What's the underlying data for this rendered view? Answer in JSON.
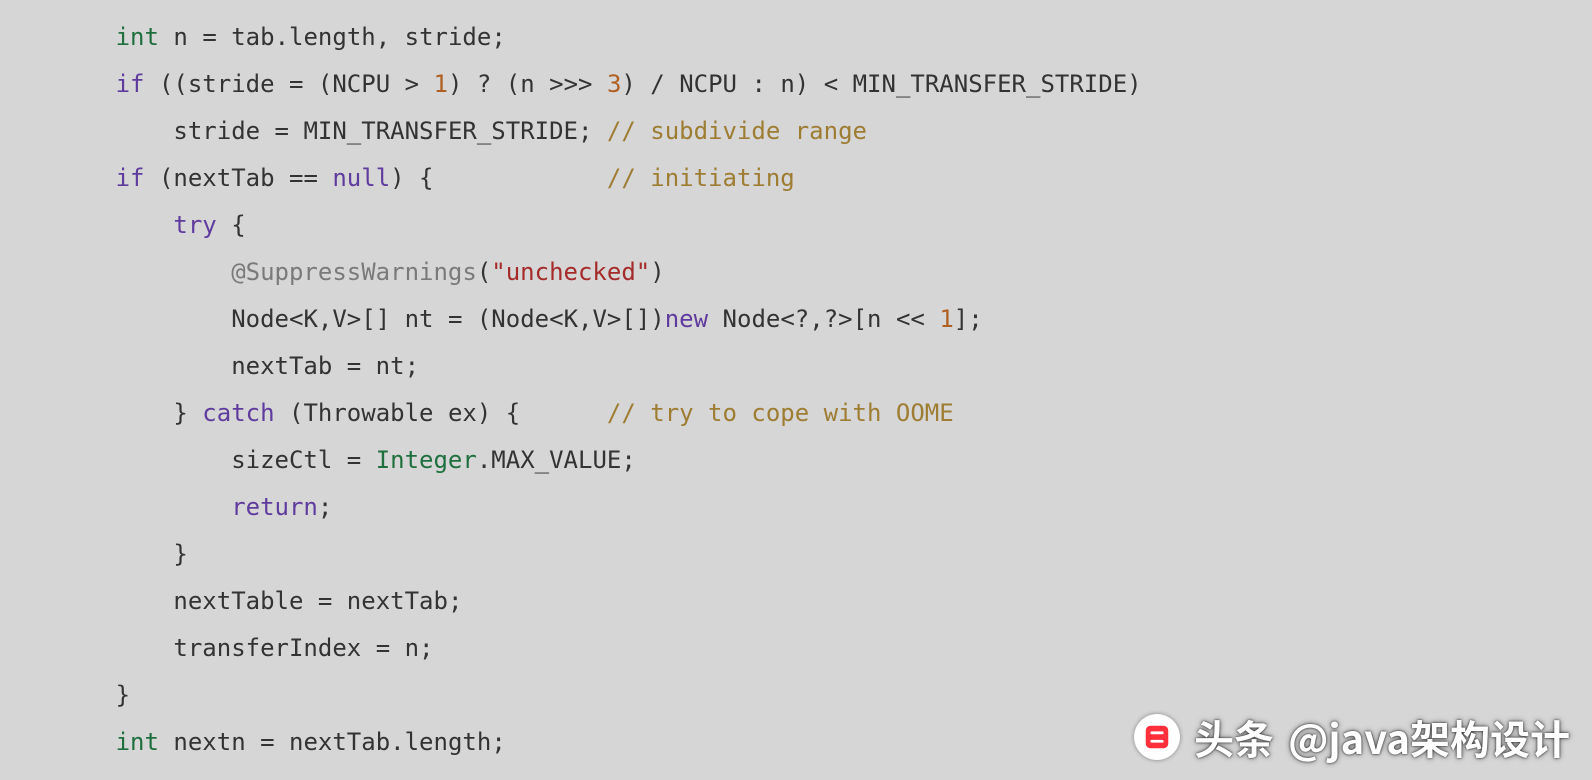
{
  "code": {
    "indent": "        ",
    "lines": [
      [
        {
          "cls": "type",
          "t": "int"
        },
        {
          "cls": "op",
          "t": " n "
        },
        {
          "cls": "op",
          "t": "="
        },
        {
          "cls": "op",
          "t": " tab"
        },
        {
          "cls": "op",
          "t": "."
        },
        {
          "cls": "id",
          "t": "length"
        },
        {
          "cls": "op",
          "t": ", stride;"
        }
      ],
      [
        {
          "cls": "kw",
          "t": "if"
        },
        {
          "cls": "op",
          "t": " ((stride "
        },
        {
          "cls": "op",
          "t": "="
        },
        {
          "cls": "op",
          "t": " (NCPU "
        },
        {
          "cls": "op",
          "t": ">"
        },
        {
          "cls": "op",
          "t": " "
        },
        {
          "cls": "num",
          "t": "1"
        },
        {
          "cls": "op",
          "t": ") "
        },
        {
          "cls": "op",
          "t": "?"
        },
        {
          "cls": "op",
          "t": " (n "
        },
        {
          "cls": "op",
          "t": ">>>"
        },
        {
          "cls": "op",
          "t": " "
        },
        {
          "cls": "num",
          "t": "3"
        },
        {
          "cls": "op",
          "t": ") "
        },
        {
          "cls": "op",
          "t": "/"
        },
        {
          "cls": "op",
          "t": " NCPU "
        },
        {
          "cls": "op",
          "t": ":"
        },
        {
          "cls": "op",
          "t": " n) "
        },
        {
          "cls": "op",
          "t": "<"
        },
        {
          "cls": "op",
          "t": " MIN_TRANSFER_STRIDE)"
        }
      ],
      [
        {
          "cls": "op",
          "t": "    stride "
        },
        {
          "cls": "op",
          "t": "="
        },
        {
          "cls": "op",
          "t": " MIN_TRANSFER_STRIDE; "
        },
        {
          "cls": "cm",
          "t": "// subdivide range"
        }
      ],
      [
        {
          "cls": "kw",
          "t": "if"
        },
        {
          "cls": "op",
          "t": " (nextTab "
        },
        {
          "cls": "op",
          "t": "=="
        },
        {
          "cls": "op",
          "t": " "
        },
        {
          "cls": "kw",
          "t": "null"
        },
        {
          "cls": "op",
          "t": ") {            "
        },
        {
          "cls": "cm",
          "t": "// initiating"
        }
      ],
      [
        {
          "cls": "op",
          "t": "    "
        },
        {
          "cls": "kw",
          "t": "try"
        },
        {
          "cls": "op",
          "t": " {"
        }
      ],
      [
        {
          "cls": "op",
          "t": "        "
        },
        {
          "cls": "ann",
          "t": "@SuppressWarnings"
        },
        {
          "cls": "op",
          "t": "("
        },
        {
          "cls": "str",
          "t": "\"unchecked\""
        },
        {
          "cls": "op",
          "t": ")"
        }
      ],
      [
        {
          "cls": "op",
          "t": "        Node"
        },
        {
          "cls": "op",
          "t": "<"
        },
        {
          "cls": "id",
          "t": "K"
        },
        {
          "cls": "op",
          "t": ","
        },
        {
          "cls": "id",
          "t": "V"
        },
        {
          "cls": "op",
          "t": ">"
        },
        {
          "cls": "op",
          "t": "[] nt "
        },
        {
          "cls": "op",
          "t": "="
        },
        {
          "cls": "op",
          "t": " (Node"
        },
        {
          "cls": "op",
          "t": "<"
        },
        {
          "cls": "id",
          "t": "K"
        },
        {
          "cls": "op",
          "t": ","
        },
        {
          "cls": "id",
          "t": "V"
        },
        {
          "cls": "op",
          "t": ">"
        },
        {
          "cls": "op",
          "t": "[])"
        },
        {
          "cls": "kw",
          "t": "new"
        },
        {
          "cls": "op",
          "t": " Node"
        },
        {
          "cls": "op",
          "t": "<"
        },
        {
          "cls": "op",
          "t": "?,"
        },
        {
          "cls": "op",
          "t": "?"
        },
        {
          "cls": "op",
          "t": ">"
        },
        {
          "cls": "op",
          "t": "[n "
        },
        {
          "cls": "op",
          "t": "<<"
        },
        {
          "cls": "op",
          "t": " "
        },
        {
          "cls": "num",
          "t": "1"
        },
        {
          "cls": "op",
          "t": "];"
        }
      ],
      [
        {
          "cls": "op",
          "t": "        nextTab "
        },
        {
          "cls": "op",
          "t": "="
        },
        {
          "cls": "op",
          "t": " nt;"
        }
      ],
      [
        {
          "cls": "op",
          "t": "    } "
        },
        {
          "cls": "kw",
          "t": "catch"
        },
        {
          "cls": "op",
          "t": " (Throwable ex) {      "
        },
        {
          "cls": "cm",
          "t": "// try to cope with OOME"
        }
      ],
      [
        {
          "cls": "op",
          "t": "        sizeCtl "
        },
        {
          "cls": "op",
          "t": "="
        },
        {
          "cls": "op",
          "t": " "
        },
        {
          "cls": "type",
          "t": "Integer"
        },
        {
          "cls": "op",
          "t": "."
        },
        {
          "cls": "id",
          "t": "MAX_VALUE"
        },
        {
          "cls": "op",
          "t": ";"
        }
      ],
      [
        {
          "cls": "op",
          "t": "        "
        },
        {
          "cls": "kw",
          "t": "return"
        },
        {
          "cls": "op",
          "t": ";"
        }
      ],
      [
        {
          "cls": "op",
          "t": "    }"
        }
      ],
      [
        {
          "cls": "op",
          "t": "    nextTable "
        },
        {
          "cls": "op",
          "t": "="
        },
        {
          "cls": "op",
          "t": " nextTab;"
        }
      ],
      [
        {
          "cls": "op",
          "t": "    transferIndex "
        },
        {
          "cls": "op",
          "t": "="
        },
        {
          "cls": "op",
          "t": " n;"
        }
      ],
      [
        {
          "cls": "op",
          "t": "}"
        }
      ],
      [
        {
          "cls": "type",
          "t": "int"
        },
        {
          "cls": "op",
          "t": " nextn "
        },
        {
          "cls": "op",
          "t": "="
        },
        {
          "cls": "op",
          "t": " nextTab"
        },
        {
          "cls": "op",
          "t": "."
        },
        {
          "cls": "id",
          "t": "length"
        },
        {
          "cls": "op",
          "t": ";"
        }
      ]
    ]
  },
  "watermark": {
    "prefix": "头条",
    "handle": "@java架构设计"
  }
}
